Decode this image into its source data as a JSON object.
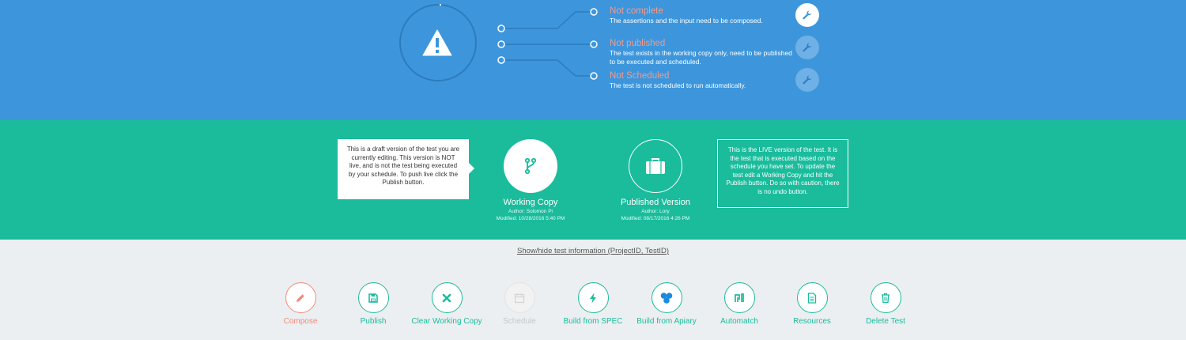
{
  "status": {
    "items": [
      {
        "title": "Not complete",
        "description": "The assertions and the input need to be composed."
      },
      {
        "title": "Not published",
        "description": "The test exists in the working copy only, need to be published to be executed and scheduled."
      },
      {
        "title": "Not Scheduled",
        "description": "The test is not scheduled to run automatically."
      }
    ],
    "icons": {
      "main": "warning-triangle-icon",
      "action": "wrench-icon"
    }
  },
  "versions": {
    "working_tooltip": "This is a draft version of the test you are currently editing. This version is NOT live, and is not the test being executed by your schedule. To push live click the Publish button.",
    "live_tooltip": "This is the LIVE version of the test. It is the test that is executed based on the schedule you have set. To update the test edit a Working Copy and hit the Publish button. Do so with caution, there is no undo button.",
    "working": {
      "title": "Working Copy",
      "author": "Author: Solomon Pi",
      "modified": "Modified: 10/28/2016 5:40 PM",
      "icon": "git-branch-icon"
    },
    "published": {
      "title": "Published Version",
      "author": "Author: Lory",
      "modified": "Modified: 08/17/2016 4:26 PM",
      "icon": "briefcase-icon"
    }
  },
  "info_link": "Show/hide test information (ProjectID, TestID)",
  "actions": [
    {
      "label": "Compose",
      "icon": "pencil-icon"
    },
    {
      "label": "Publish",
      "icon": "save-icon"
    },
    {
      "label": "Clear Working Copy",
      "icon": "close-icon"
    },
    {
      "label": "Schedule",
      "icon": "calendar-icon"
    },
    {
      "label": "Build from SPEC",
      "icon": "lightning-icon"
    },
    {
      "label": "Build from Apiary",
      "icon": "apiary-icon"
    },
    {
      "label": "Automatch",
      "icon": "automatch-icon"
    },
    {
      "label": "Resources",
      "icon": "document-icon"
    },
    {
      "label": "Delete Test",
      "icon": "trash-icon"
    }
  ],
  "colors": {
    "status_bg": "#3d96dc",
    "version_bg": "#1abc9c",
    "accent": "#1abc9c",
    "compose": "#f08a7a",
    "warning_title": "#f29a8a"
  }
}
